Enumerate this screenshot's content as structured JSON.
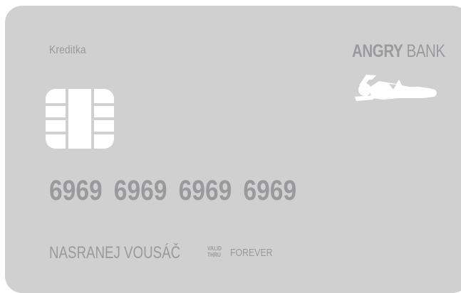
{
  "card": {
    "type_label": "Kreditka",
    "bank": {
      "name_bold": "ANGRY",
      "name_regular": "BANK",
      "logo_icon": "sleeping-person-icon"
    },
    "chip_icon": "card-chip-icon",
    "number": "6969 6969 6969 6969",
    "holder_name": "NASRANEJ VOUSÁČ",
    "valid_thru_line1": "VALID",
    "valid_thru_line2": "THRU",
    "expiry": "FOREVER"
  },
  "colors": {
    "card_background": "#d0d0d1",
    "text": "#9a9a9c",
    "emblem": "#ffffff"
  }
}
